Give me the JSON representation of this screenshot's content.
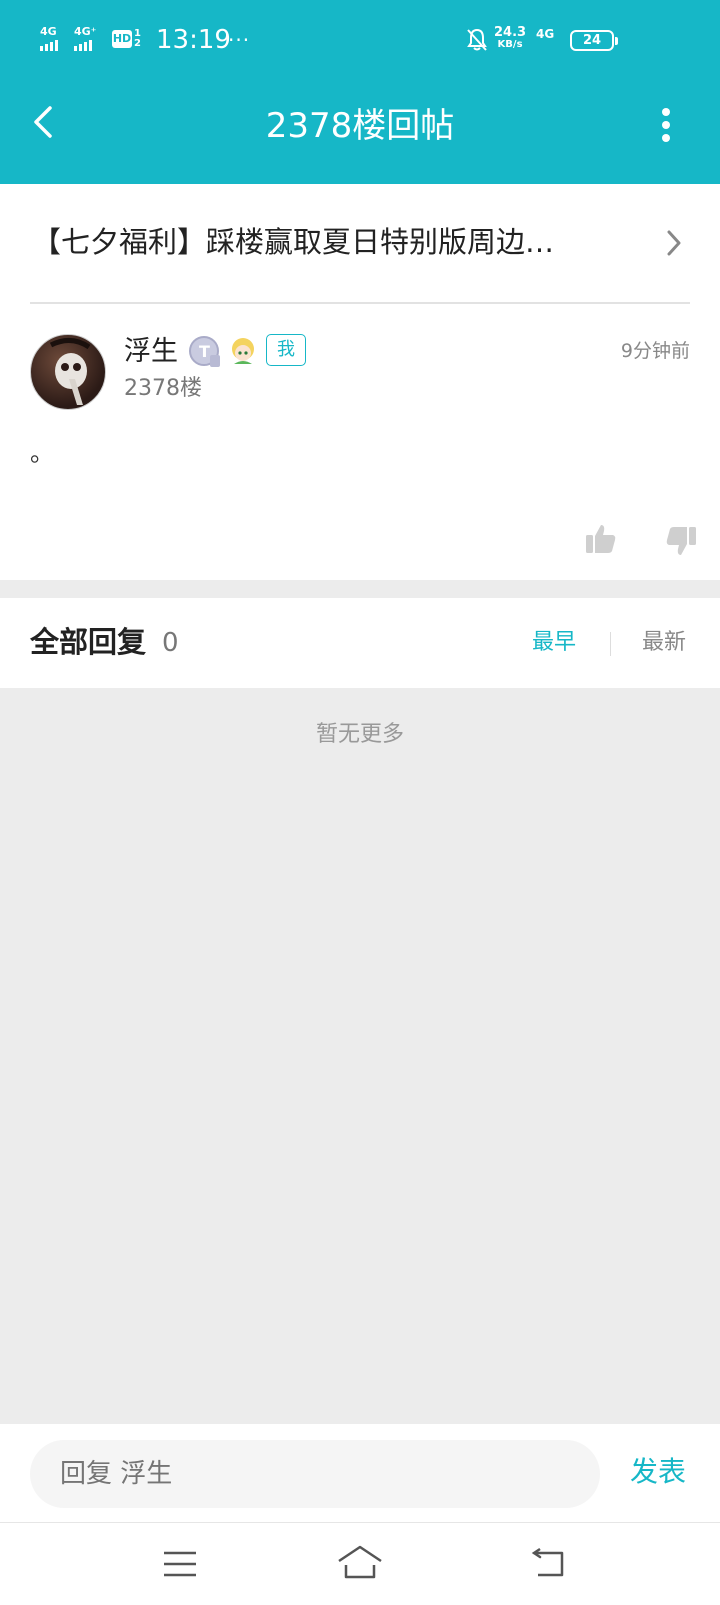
{
  "status_bar": {
    "net1": "4G",
    "net2": "4G⁺",
    "hd": "HD",
    "hd_sub": "1 2",
    "time": "13:19",
    "dots": "···",
    "speed_value": "24.3",
    "speed_unit": "KB/s",
    "net3": "4G",
    "battery": "24"
  },
  "header": {
    "title": "2378楼回帖"
  },
  "thread": {
    "title": "【七夕福利】踩楼赢取夏日特别版周边…"
  },
  "post": {
    "username": "浮生",
    "me_tag": "我",
    "floor": "2378楼",
    "time_ago": "9分钟前",
    "content": "。"
  },
  "replies": {
    "label": "全部回复",
    "count": "0",
    "sort_earliest": "最早",
    "sort_newest": "最新",
    "empty_text": "暂无更多"
  },
  "reply_bar": {
    "placeholder": "回复 浮生",
    "send_label": "发表"
  },
  "colors": {
    "accent": "#16b7c7",
    "background": "#ececec"
  },
  "icons": [
    "back-icon",
    "more-icon",
    "chevron-right-icon",
    "thumbs-up-icon",
    "thumbs-down-icon",
    "menu-icon",
    "home-icon",
    "return-icon",
    "mute-bell-icon"
  ]
}
